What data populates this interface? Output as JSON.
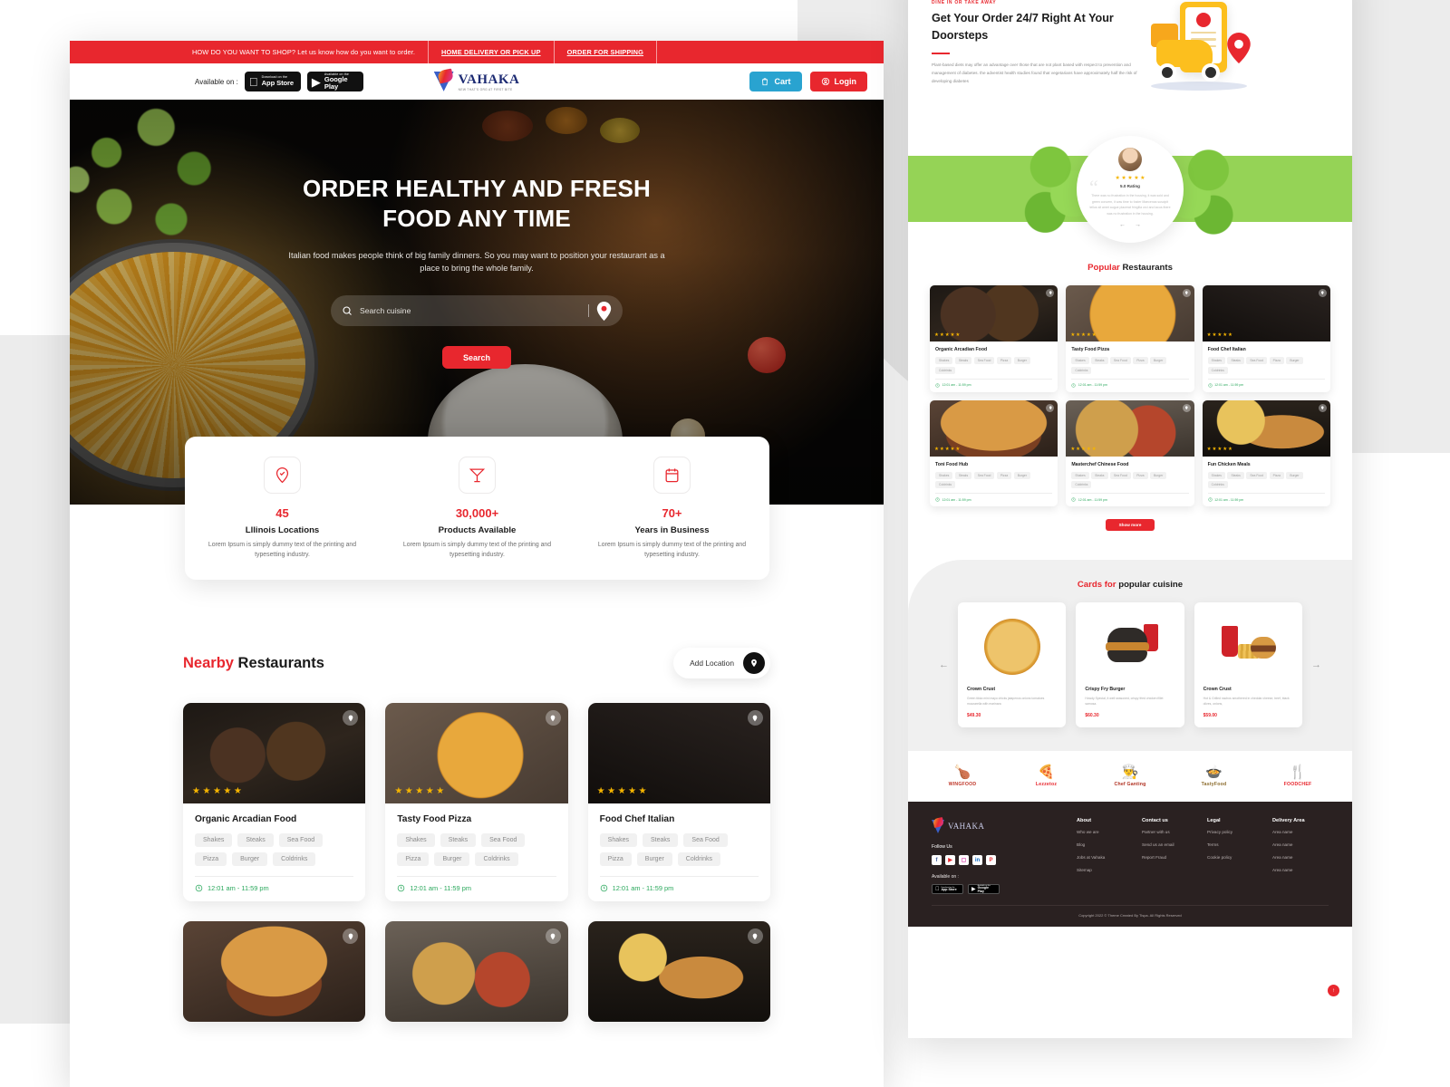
{
  "topbar": {
    "message": "HOW DO YOU WANT TO SHOP? Let us know how do you want to order.",
    "link_delivery": "HOME DELIVERY OR PICK UP",
    "link_shipping": "ORDER FOR SHIPPING"
  },
  "nav": {
    "available_label": "Available on :",
    "appstore_small": "Download on the",
    "appstore_big": "App Store",
    "googleplay_small": "Available on the",
    "googleplay_big": "Google Play",
    "brand_name": "VAHAKA",
    "brand_tagline": "NEW THAT'S ORG AT FIRST BITE",
    "cart_label": "Cart",
    "login_label": "Login"
  },
  "hero": {
    "title_line1": "ORDER HEALTHY AND FRESH",
    "title_line2": "FOOD ANY TIME",
    "subtitle": "Italian food makes people think of big family dinners. So you may want to position your restaurant as a place to bring the whole family.",
    "search_placeholder": "Search cuisine",
    "search_value": "",
    "search_button": "Search"
  },
  "stats": [
    {
      "icon": "location-check-icon",
      "number": "45",
      "label": "Lllinois Locations",
      "desc": "Lorem Ipsum is simply dummy text of the printing and typesetting industry."
    },
    {
      "icon": "cocktail-icon",
      "number": "30,000+",
      "label": "Products Available",
      "desc": "Lorem Ipsum is simply dummy text of the printing and typesetting industry."
    },
    {
      "icon": "calendar-icon",
      "number": "70+",
      "label": "Years in Business",
      "desc": "Lorem Ipsum is simply dummy text of the printing and typesetting industry."
    }
  ],
  "nearby": {
    "title_highlight": "Nearby",
    "title_rest": "Restaurants",
    "add_location": "Add Location",
    "cards": [
      {
        "name": "Organic Arcadian Food",
        "stars": 5,
        "hours": "12:01 am - 11:59 pm",
        "tags": [
          "Shakes",
          "Steaks",
          "Sea Food",
          "Pizza",
          "Burger",
          "Coldrinks"
        ],
        "art": "img-coffee"
      },
      {
        "name": "Tasty Food Pizza",
        "stars": 5,
        "hours": "12:01 am - 11:59 pm",
        "tags": [
          "Shakes",
          "Steaks",
          "Sea Food",
          "Pizza",
          "Burger",
          "Coldrinks"
        ],
        "art": "img-pizza"
      },
      {
        "name": "Food Chef Italian",
        "stars": 5,
        "hours": "12:01 am - 11:59 pm",
        "tags": [
          "Shakes",
          "Steaks",
          "Sea Food",
          "Pizza",
          "Burger",
          "Coldrinks"
        ],
        "art": "img-hotdog"
      }
    ],
    "cards_row2": [
      {
        "art": "img-burger1"
      },
      {
        "art": "img-combo"
      },
      {
        "art": "img-burger2"
      }
    ]
  },
  "doorstep": {
    "eyebrow": "DINE IN OR TAKE AWAY",
    "title": "Get Your Order 24/7 Right At Your Doorsteps",
    "body": "Plant-based diets may offer an advantage over those that are not plant based with respect to prevention and management of diabetes. the adventist health studies found that vegetarians have approximately half the risk of developing diabetes"
  },
  "testimonial": {
    "rating_label": "5.0 Rating",
    "stars": 5,
    "quote_mark": "“",
    "text": "There was no frustration in the housing, it was sold and green concern, it was time to foster Maecenas suscipit tellus sit amet augue placerat fringilla orci and lacus there was no frustration in the housing."
  },
  "popular": {
    "title_highlight": "Popular",
    "title_rest": "Restaurants",
    "show_more": "Show more",
    "tags": [
      "Shakes",
      "Steaks",
      "Sea Food",
      "Pizza",
      "Burger",
      "Coldrinks"
    ],
    "cards": [
      {
        "name": "Organic Arcadian Food",
        "stars": 5,
        "hours": "12:01 am - 11:59 pm",
        "art": "img-coffee"
      },
      {
        "name": "Tasty Food Pizza",
        "stars": 5,
        "hours": "12:01 am - 11:59 pm",
        "art": "img-pizza"
      },
      {
        "name": "Food Chef Italian",
        "stars": 5,
        "hours": "12:01 am - 11:59 pm",
        "art": "img-hotdog"
      },
      {
        "name": "Toni Food Hub",
        "stars": 5,
        "hours": "12:01 am - 11:59 pm",
        "art": "img-burger1"
      },
      {
        "name": "Masterchef Chinese Food",
        "stars": 5,
        "hours": "12:01 am - 11:59 pm",
        "art": "img-combo"
      },
      {
        "name": "Fun Chicken Meals",
        "stars": 5,
        "hours": "12:01 am - 11:59 pm",
        "art": "img-burger2"
      }
    ]
  },
  "cuisine": {
    "title_highlight": "Cards for",
    "title_rest": "popular cuisine",
    "prev_arrow": "←",
    "next_arrow": "→",
    "cards": [
      {
        "name": "Crown Crust",
        "desc": "Green tikka mini mayo chicks jalapenos onions tomatoes mozzarella with marinara",
        "price": "$49.30",
        "art": "pizza"
      },
      {
        "name": "Crispy Fry Burger",
        "desc": "Howdy Special, it well seasoned, crispy fried chicken fillet samosa.",
        "price": "$60.30",
        "art": "burger"
      },
      {
        "name": "Crown Crust",
        "desc": "Hot & Grilled nachos smothered in cheddar cheese, beef, black olives, onions,",
        "price": "$59.00",
        "art": "fries"
      }
    ]
  },
  "brands": [
    {
      "name": "WINGFOOD",
      "glyph": "🍗",
      "color": "#c0392b"
    },
    {
      "name": "Lezzetoz",
      "glyph": "🍕",
      "color": "#e8272e"
    },
    {
      "name": "Chef Ganting",
      "glyph": "👨‍🍳",
      "color": "#b03020"
    },
    {
      "name": "TastyFood",
      "glyph": "🍲",
      "color": "#8a6a2a"
    },
    {
      "name": "FOODCHEF",
      "glyph": "🍴",
      "color": "#e8272e"
    }
  ],
  "footer": {
    "brand_name": "VAHAKA",
    "follow_label": "Follow Us",
    "socials": [
      "f",
      "▶",
      "▢",
      "in",
      "P"
    ],
    "available_label": "Available on :",
    "appstore_small": "Download on the",
    "appstore_big": "App Store",
    "googleplay_small": "Available on the",
    "googleplay_big": "Google Play",
    "columns": [
      {
        "head": "About",
        "links": [
          "Who we are",
          "Blog",
          "Jobs at Vahaka",
          "Sitemap"
        ]
      },
      {
        "head": "Contact us",
        "links": [
          "Partner with us",
          "Send us an email",
          "Report Fraud"
        ]
      },
      {
        "head": "Legal",
        "links": [
          "Privacy policy",
          "Terms",
          "Cookie policy"
        ]
      },
      {
        "head": "Delivery Area",
        "links": [
          "Area name",
          "Area name",
          "Area name",
          "Area name"
        ]
      }
    ],
    "copyright": "Copyright 2022 © Theme Created By Tispa. All Rights Reserved",
    "fab": "↑"
  }
}
